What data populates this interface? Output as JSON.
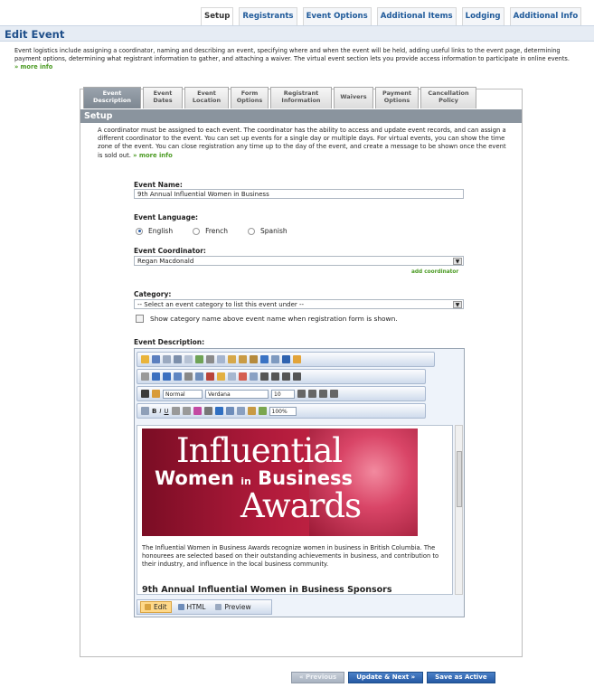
{
  "top_tabs": [
    "Setup",
    "Registrants",
    "Event Options",
    "Additional Items",
    "Lodging",
    "Additional Info"
  ],
  "page_title": "Edit Event",
  "intro": {
    "text": "Event logistics include assigning a coordinator, naming and describing an event, specifying where and when the event will be held, adding useful links to the event page, determining payment options, determining what registrant information to gather, and attaching a waiver. The virtual event section lets you provide access information to participate in online events.",
    "more": "» more info"
  },
  "sub_tabs": [
    {
      "l1": "Event",
      "l2": "Description"
    },
    {
      "l1": "Event",
      "l2": "Dates"
    },
    {
      "l1": "Event",
      "l2": "Location"
    },
    {
      "l1": "Form",
      "l2": "Options"
    },
    {
      "l1": "Registrant",
      "l2": "Information"
    },
    {
      "l1": "Waivers",
      "l2": ""
    },
    {
      "l1": "Payment",
      "l2": "Options"
    },
    {
      "l1": "Cancellation",
      "l2": "Policy"
    }
  ],
  "section_title": "Setup",
  "setup_text": "A coordinator must be assigned to each event. The coordinator has the ability to access and update event records, and can assign a different coordinator to the event. You can set up events for a single day or multiple days. For virtual events, you can show the time zone of the event. You can close registration any time up to the day of the event, and create a message to be shown once the event is sold out.",
  "setup_more": "» more info",
  "event_name_label": "Event Name:",
  "event_name_value": "9th Annual Influential Women in Business",
  "language_label": "Event Language:",
  "languages": [
    "English",
    "French",
    "Spanish"
  ],
  "coordinator_label": "Event Coordinator:",
  "coordinator_value": "Regan Macdonald",
  "add_coordinator": "add coordinator",
  "category_label": "Category:",
  "category_value": "-- Select an event category to list this event under --",
  "category_checkbox": "Show category name above event name when registration form is shown.",
  "description_label": "Event Description:",
  "editor": {
    "style_value": "Normal",
    "font_value": "Verdana",
    "size_value": "10",
    "zoom_value": "100%",
    "banner": {
      "line1": "Influential",
      "line2a": "Women",
      "line2b": "in",
      "line2c": "Business",
      "line3": "Awards"
    },
    "body_text": "The Influential Women in Business Awards recognize women in business in British Columbia. The honourees are selected based on their outstanding achievements in business, and contribution to their industry, and influence in the local business community.",
    "body_title": "9th Annual Influential Women in Business Sponsors",
    "modes": [
      "Edit",
      "HTML",
      "Preview"
    ]
  },
  "buttons": {
    "previous": "« Previous",
    "update_next": "Update & Next »",
    "save_active": "Save as Active"
  }
}
